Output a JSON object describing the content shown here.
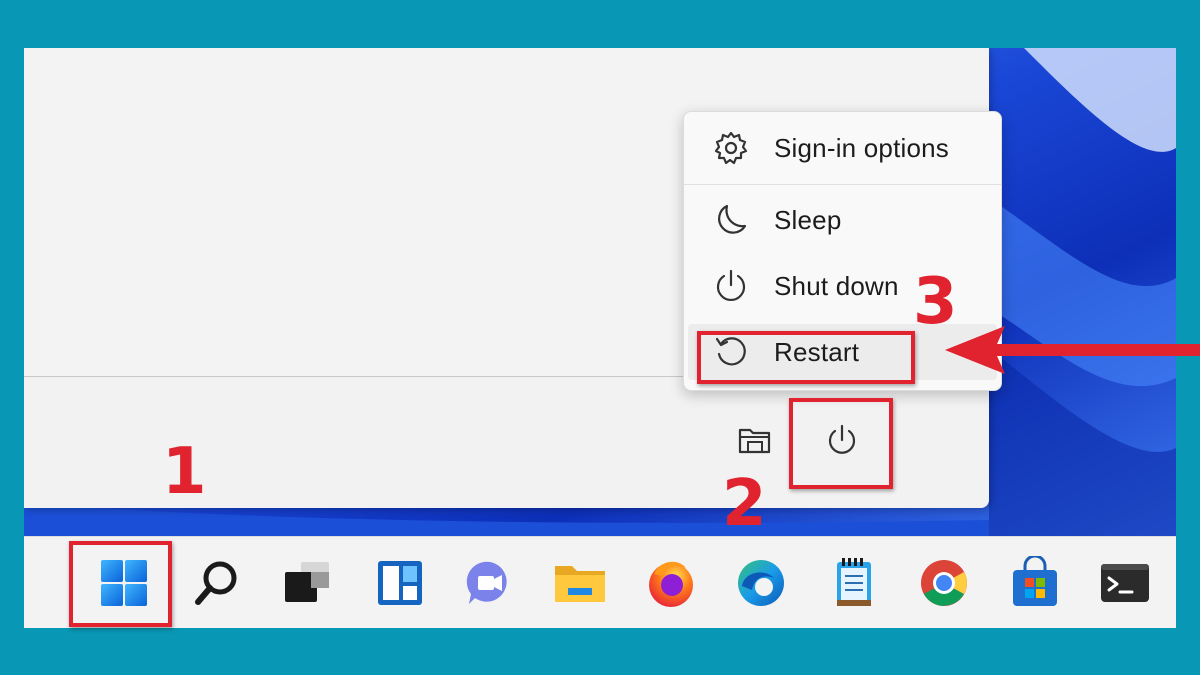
{
  "power_menu": {
    "items": [
      {
        "label": "Sign-in options",
        "icon": "gear-icon"
      },
      {
        "label": "Sleep",
        "icon": "moon-icon"
      },
      {
        "label": "Shut down",
        "icon": "power-icon"
      },
      {
        "label": "Restart",
        "icon": "restart-icon"
      }
    ]
  },
  "start_menu_footer": {
    "icons": [
      "folder-icon",
      "power-icon"
    ]
  },
  "taskbar": {
    "icons": [
      "windows-start-icon",
      "search-icon",
      "task-view-icon",
      "widgets-icon",
      "teams-chat-icon",
      "file-explorer-icon",
      "firefox-icon",
      "edge-icon",
      "notepad-icon",
      "chrome-icon",
      "microsoft-store-icon",
      "terminal-icon"
    ]
  },
  "annotations": {
    "step1": "1",
    "step2": "2",
    "step3": "3",
    "highlight_color": "#e0232e"
  },
  "colors": {
    "frame": "#0897b4",
    "menu_bg": "#f2f2f2",
    "taskbar_bg": "#f3f3f3"
  }
}
